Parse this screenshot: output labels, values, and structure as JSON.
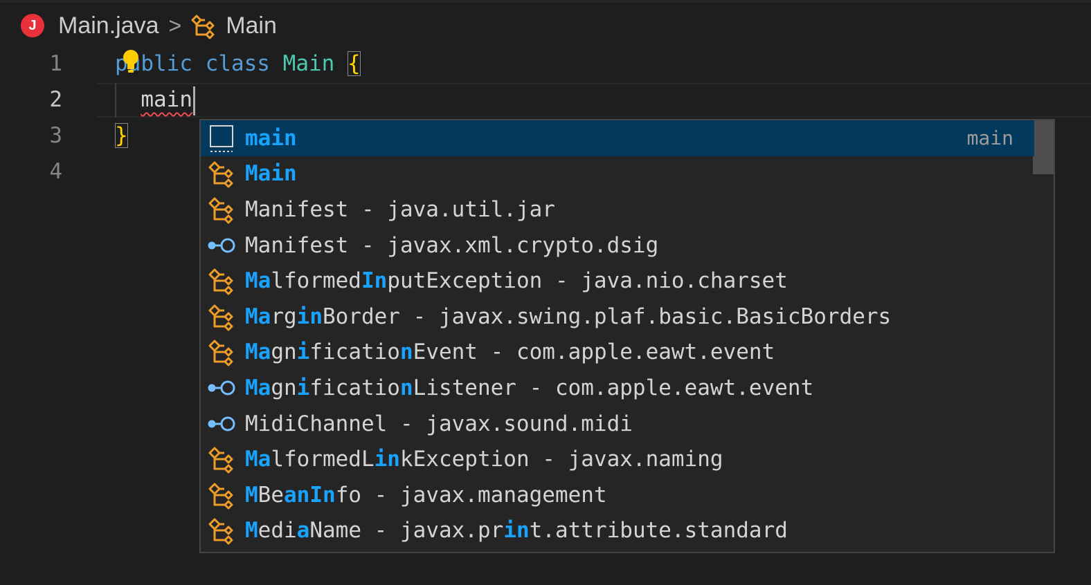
{
  "breadcrumb": {
    "file_icon_letter": "J",
    "file": "Main.java",
    "separator": ">",
    "symbol": "Main"
  },
  "gutter": [
    "1",
    "2",
    "3",
    "4"
  ],
  "code": {
    "line1": {
      "kw1": "public",
      "kw2": "class",
      "name": "Main",
      "brace": "{"
    },
    "line2": {
      "typed": "main"
    },
    "line3": {
      "brace": "}"
    }
  },
  "suggestions": [
    {
      "kind": "snippet",
      "segments": [
        {
          "t": "main",
          "h": true
        }
      ],
      "detail": "main"
    },
    {
      "kind": "class",
      "segments": [
        {
          "t": "Main",
          "h": true
        }
      ]
    },
    {
      "kind": "class",
      "segments": [
        {
          "t": "Manifest - java.util.jar",
          "h": false
        }
      ]
    },
    {
      "kind": "interface",
      "segments": [
        {
          "t": "Manifest - javax.xml.crypto.dsig",
          "h": false
        }
      ]
    },
    {
      "kind": "class",
      "segments": [
        {
          "t": "Ma",
          "h": true
        },
        {
          "t": "lformed",
          "h": false
        },
        {
          "t": "In",
          "h": true
        },
        {
          "t": "putException - java.nio.charset",
          "h": false
        }
      ]
    },
    {
      "kind": "class",
      "segments": [
        {
          "t": "Ma",
          "h": true
        },
        {
          "t": "rg",
          "h": false
        },
        {
          "t": "in",
          "h": true
        },
        {
          "t": "Border - javax.swing.plaf.basic.BasicBorders",
          "h": false
        }
      ]
    },
    {
      "kind": "class",
      "segments": [
        {
          "t": "Ma",
          "h": true
        },
        {
          "t": "gn",
          "h": false
        },
        {
          "t": "i",
          "h": true
        },
        {
          "t": "ficatio",
          "h": false
        },
        {
          "t": "n",
          "h": true
        },
        {
          "t": "Event - com.apple.eawt.event",
          "h": false
        }
      ]
    },
    {
      "kind": "interface",
      "segments": [
        {
          "t": "Ma",
          "h": true
        },
        {
          "t": "gn",
          "h": false
        },
        {
          "t": "i",
          "h": true
        },
        {
          "t": "ficatio",
          "h": false
        },
        {
          "t": "n",
          "h": true
        },
        {
          "t": "Listener - com.apple.eawt.event",
          "h": false
        }
      ]
    },
    {
      "kind": "interface",
      "segments": [
        {
          "t": "MidiChannel - javax.sound.midi",
          "h": false
        }
      ]
    },
    {
      "kind": "class",
      "segments": [
        {
          "t": "Ma",
          "h": true
        },
        {
          "t": "lformedL",
          "h": false
        },
        {
          "t": "in",
          "h": true
        },
        {
          "t": "kException - javax.naming",
          "h": false
        }
      ]
    },
    {
      "kind": "class",
      "segments": [
        {
          "t": "M",
          "h": true
        },
        {
          "t": "Be",
          "h": false
        },
        {
          "t": "a",
          "h": true
        },
        {
          "t": "n",
          "h": true
        },
        {
          "t": "I",
          "h": true
        },
        {
          "t": "n",
          "h": true
        },
        {
          "t": "fo - javax.management",
          "h": false
        }
      ]
    },
    {
      "kind": "class",
      "segments": [
        {
          "t": "M",
          "h": true
        },
        {
          "t": "edi",
          "h": false
        },
        {
          "t": "a",
          "h": true
        },
        {
          "t": "Name - javax.pr",
          "h": false
        },
        {
          "t": "in",
          "h": true
        },
        {
          "t": "t.attribute.standard",
          "h": false
        }
      ]
    }
  ],
  "colors": {
    "class_icon": "#ee9d28",
    "interface_icon": "#75beff",
    "highlight": "#18a3ff",
    "selection": "#04395e"
  }
}
